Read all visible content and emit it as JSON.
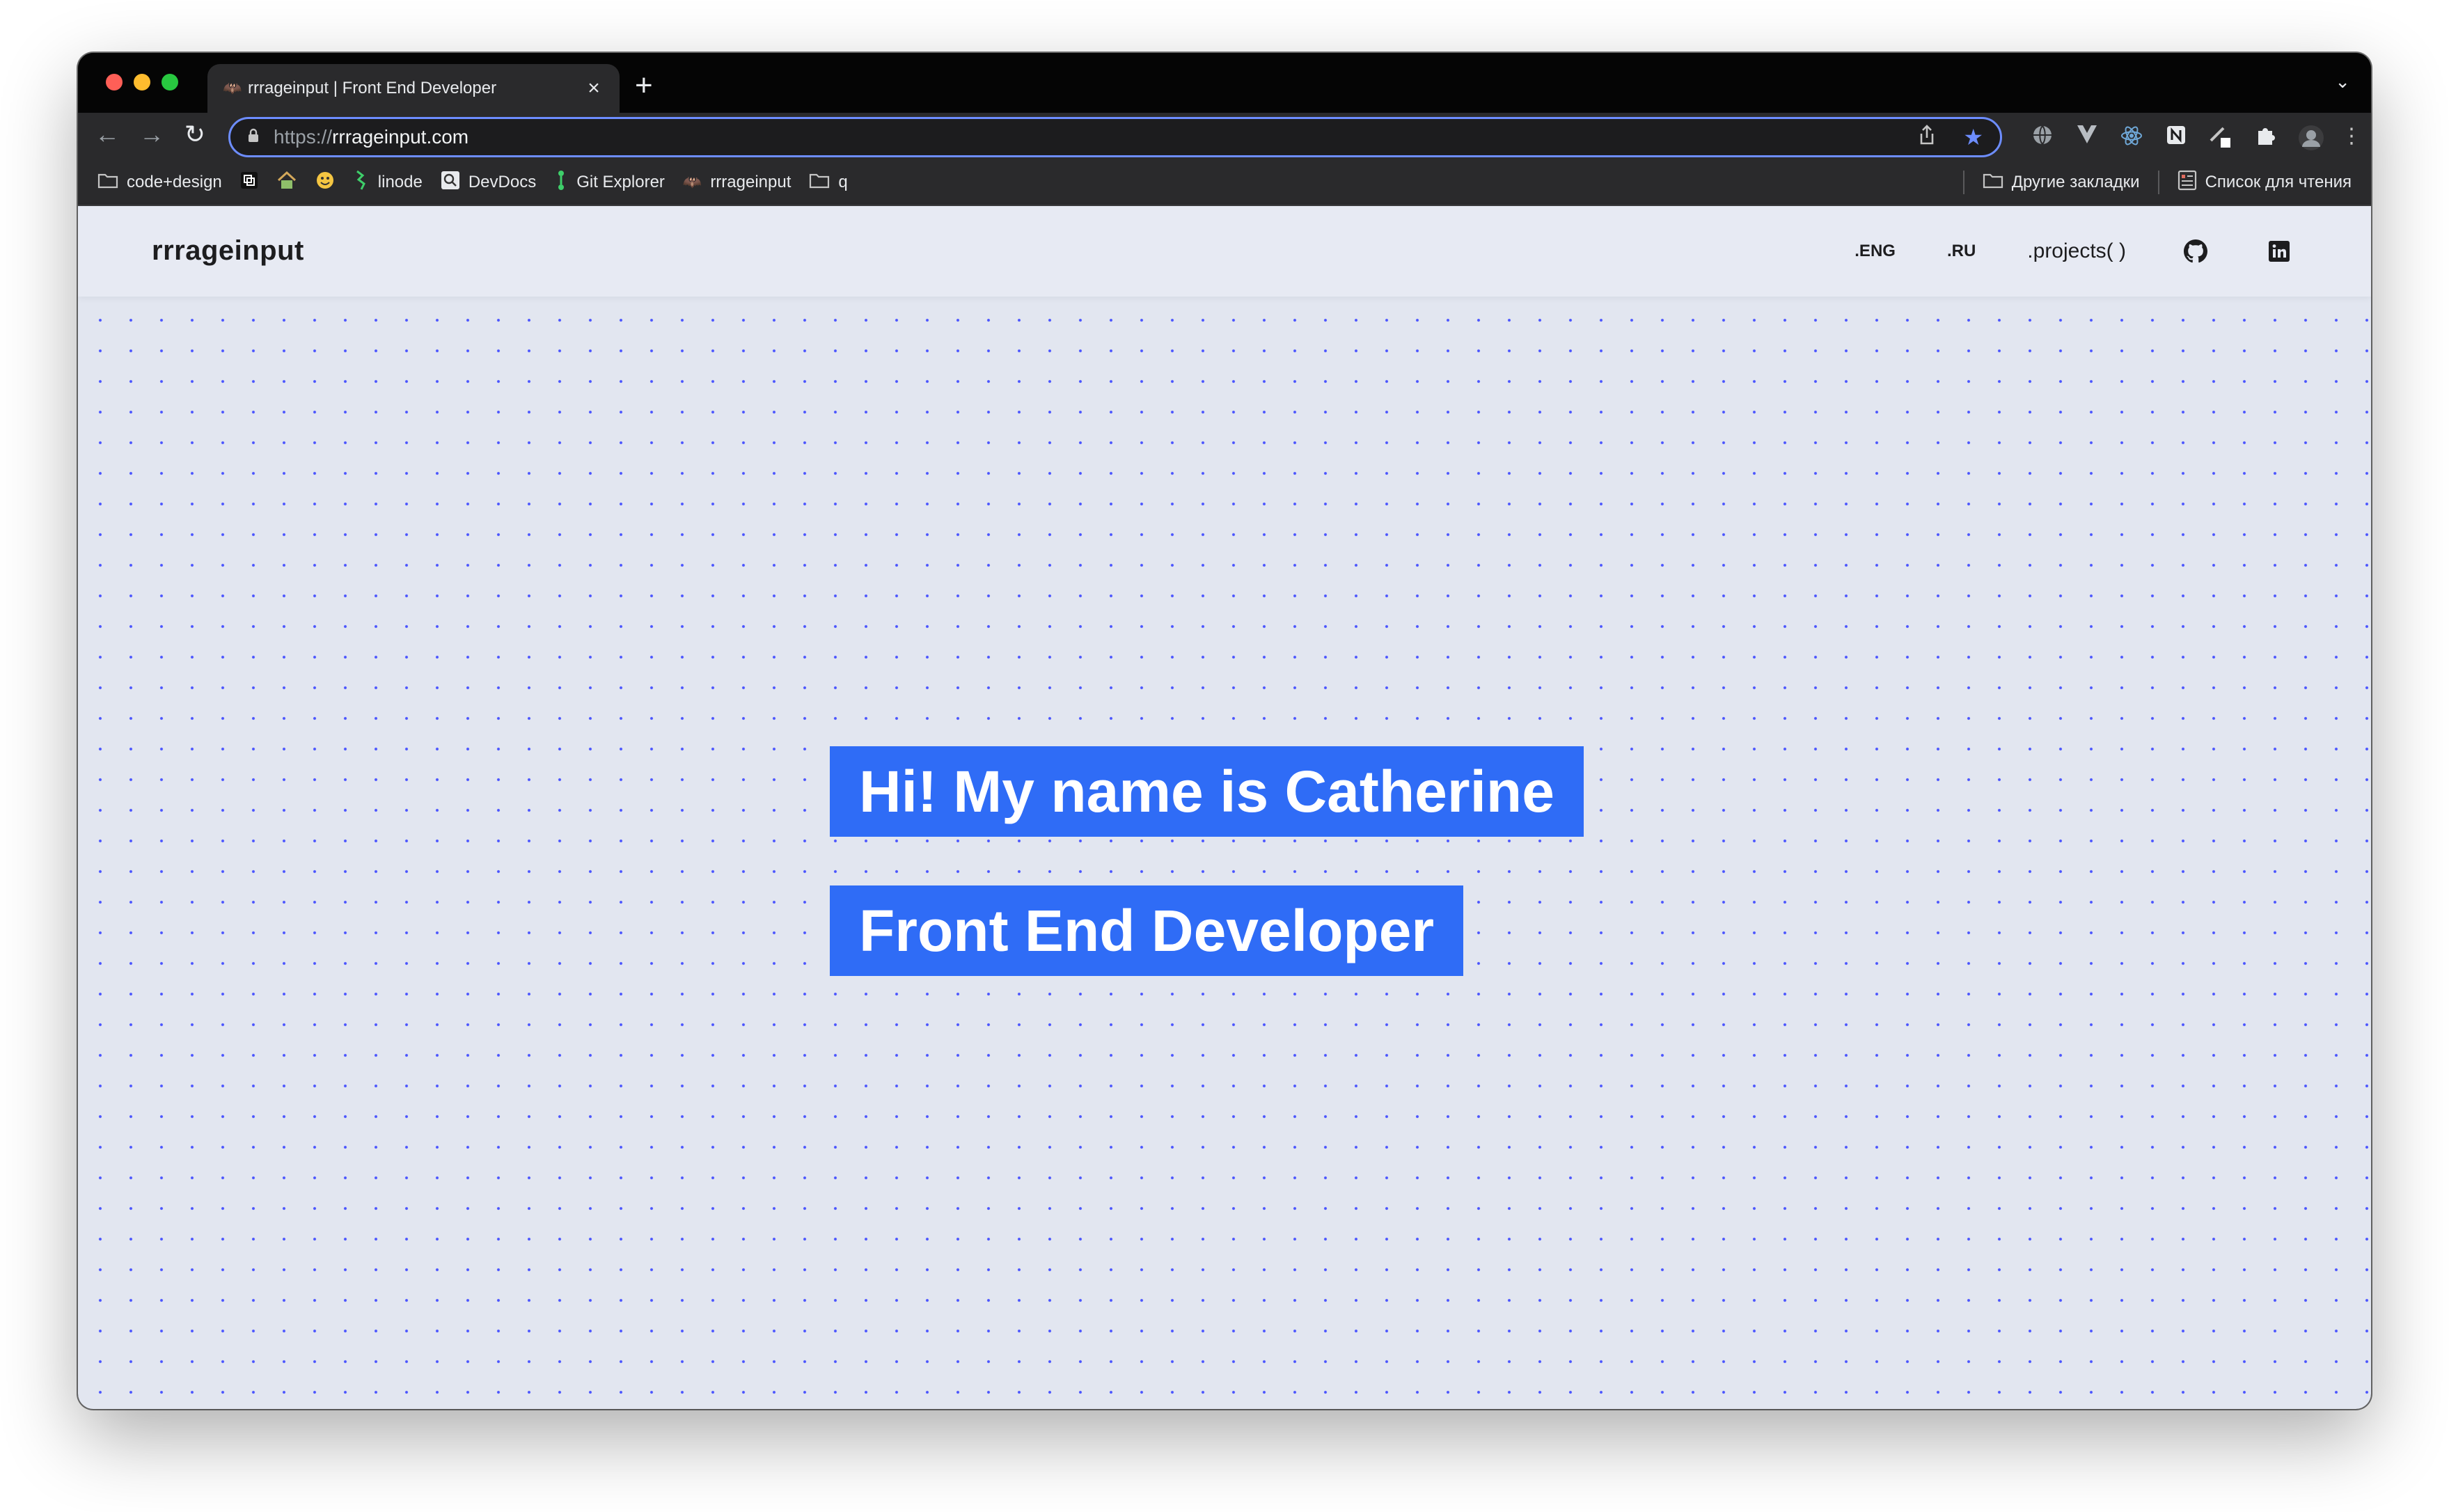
{
  "browser": {
    "tab": {
      "title": "rrrageinput | Front End Developer",
      "favicon": "🦇"
    },
    "address": {
      "scheme": "https://",
      "host": "rrrageinput.com"
    },
    "bookmarks": {
      "left": [
        {
          "label": "code+design",
          "icon": "folder-icon"
        },
        {
          "label": "",
          "icon": "app-icon"
        },
        {
          "label": "",
          "icon": "house-icon"
        },
        {
          "label": "",
          "icon": "emoji-icon"
        },
        {
          "label": "linode",
          "icon": "linode-icon"
        },
        {
          "label": "DevDocs",
          "icon": "devdocs-icon"
        },
        {
          "label": "Git Explorer",
          "icon": "git-explorer-icon"
        },
        {
          "label": "rrrageinput",
          "icon": "bat-icon"
        },
        {
          "label": "q",
          "icon": "folder-icon"
        }
      ],
      "other_bookmarks": "Другие закладки",
      "reading_list": "Список для чтения"
    },
    "colors": {
      "accent": "#6d8dff"
    }
  },
  "site": {
    "logo": "rrrageinput",
    "nav": {
      "eng": ".ENG",
      "ru": ".RU",
      "projects": ".projects( )"
    },
    "hero": {
      "line1": "Hi! My name is Catherine",
      "line2": "Front End Developer"
    },
    "colors": {
      "highlight": "#2f6cf6",
      "background": "#e2e6f0",
      "dots": "#4a54ff"
    }
  }
}
